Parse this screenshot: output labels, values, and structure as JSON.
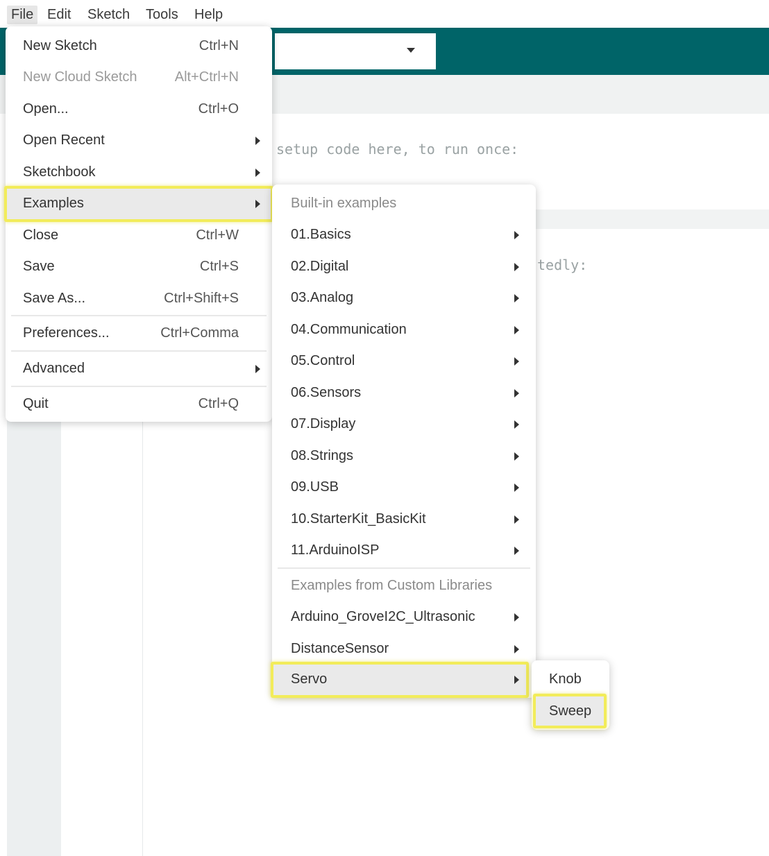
{
  "menubar": {
    "items": [
      {
        "label": "File"
      },
      {
        "label": "Edit"
      },
      {
        "label": "Sketch"
      },
      {
        "label": "Tools"
      },
      {
        "label": "Help"
      }
    ]
  },
  "editor": {
    "code_line_1": "setup code here, to run once:",
    "code_line_2": "tedly:"
  },
  "file_menu": {
    "items": [
      {
        "label": "New Sketch",
        "shortcut": "Ctrl+N"
      },
      {
        "label": "New Cloud Sketch",
        "shortcut": "Alt+Ctrl+N"
      },
      {
        "label": "Open...",
        "shortcut": "Ctrl+O"
      },
      {
        "label": "Open Recent"
      },
      {
        "label": "Sketchbook"
      },
      {
        "label": "Examples"
      },
      {
        "label": "Close",
        "shortcut": "Ctrl+W"
      },
      {
        "label": "Save",
        "shortcut": "Ctrl+S"
      },
      {
        "label": "Save As...",
        "shortcut": "Ctrl+Shift+S"
      },
      {
        "label": "Preferences...",
        "shortcut": "Ctrl+Comma"
      },
      {
        "label": "Advanced"
      },
      {
        "label": "Quit",
        "shortcut": "Ctrl+Q"
      }
    ]
  },
  "examples_menu": {
    "builtin_header": "Built-in examples",
    "builtin": [
      {
        "label": "01.Basics"
      },
      {
        "label": "02.Digital"
      },
      {
        "label": "03.Analog"
      },
      {
        "label": "04.Communication"
      },
      {
        "label": "05.Control"
      },
      {
        "label": "06.Sensors"
      },
      {
        "label": "07.Display"
      },
      {
        "label": "08.Strings"
      },
      {
        "label": "09.USB"
      },
      {
        "label": "10.StarterKit_BasicKit"
      },
      {
        "label": "11.ArduinoISP"
      }
    ],
    "custom_header": "Examples from Custom Libraries",
    "custom": [
      {
        "label": "Arduino_GroveI2C_Ultrasonic"
      },
      {
        "label": "DistanceSensor"
      },
      {
        "label": "Servo"
      }
    ]
  },
  "servo_menu": {
    "items": [
      {
        "label": "Knob"
      },
      {
        "label": "Sweep"
      }
    ]
  },
  "colors": {
    "toolbar": "#006468",
    "highlight": "#f2ec5a"
  }
}
